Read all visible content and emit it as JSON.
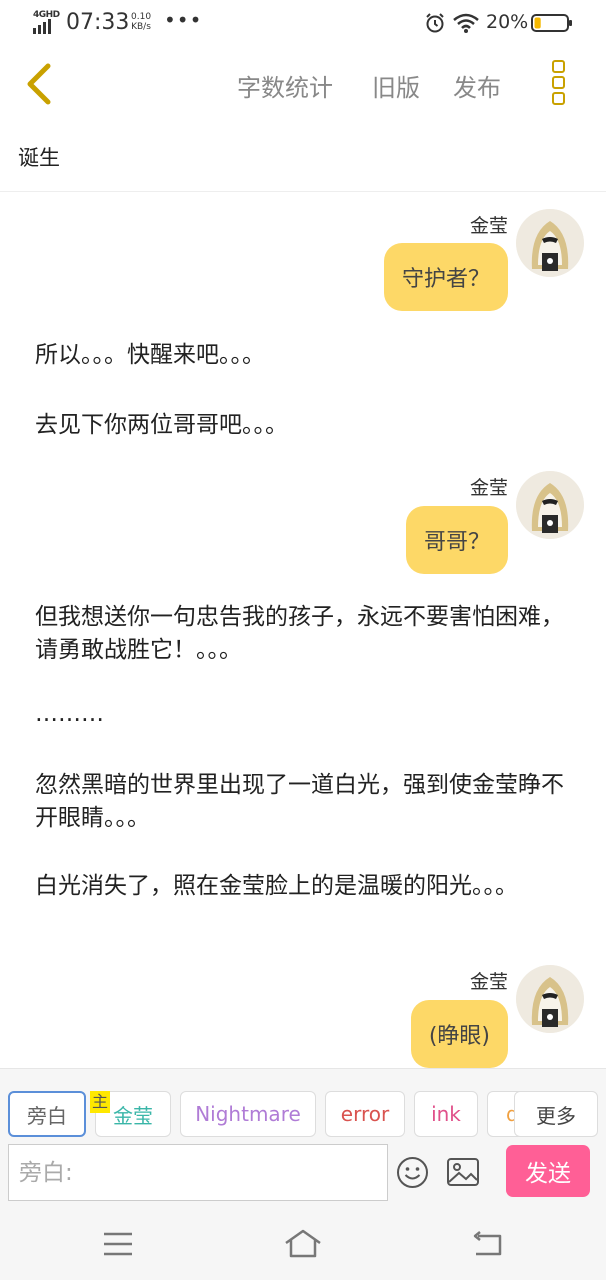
{
  "status_bar": {
    "network": "4GHD",
    "time": "07:33",
    "speed_value": "0.10",
    "speed_unit": "KB/s",
    "battery_text": "20%",
    "battery_level": 0.2,
    "icons": [
      "signal-icon",
      "alarm-icon",
      "wifi-icon",
      "battery-icon"
    ]
  },
  "header": {
    "back_icon": "chevron-left-icon",
    "word_count": "字数统计",
    "old_version": "旧版",
    "publish": "发布",
    "more_icon": "more-vertical-icon",
    "accent_color": "#c9a100"
  },
  "title": "诞生",
  "chat": {
    "bubble_color": "#fdd867",
    "messages": [
      {
        "type": "role",
        "speaker": "金莹",
        "text": "守护者？"
      },
      {
        "type": "narration",
        "text": "所以。。。快醒来吧。。。"
      },
      {
        "type": "narration",
        "text": "去见下你两位哥哥吧。。。"
      },
      {
        "type": "role",
        "speaker": "金莹",
        "text": "哥哥？"
      },
      {
        "type": "narration",
        "text": "但我想送你一句忠告我的孩子，永远不要害怕困难，请勇敢战胜它！。。。"
      },
      {
        "type": "narration",
        "text": "………"
      },
      {
        "type": "narration",
        "text": "忽然黑暗的世界里出现了一道白光，强到使金莹睁不开眼睛。。。"
      },
      {
        "type": "narration",
        "text": "白光消失了，照在金莹脸上的是温暖的阳光。。。"
      },
      {
        "type": "role",
        "speaker": "金莹",
        "text": "(睁眼)"
      }
    ]
  },
  "roles": {
    "chips": [
      {
        "label": "旁白",
        "color": "#666666",
        "selected": true
      },
      {
        "label": "金莹",
        "color": "#3ab6a8",
        "tag": "主"
      },
      {
        "label": "Nightmare",
        "color": "#b07cd6"
      },
      {
        "label": "error",
        "color": "#d9534f"
      },
      {
        "label": "ink",
        "color": "#e0508a"
      },
      {
        "label": "d",
        "color": "#f0a040"
      }
    ],
    "more": "更多"
  },
  "composer": {
    "placeholder": "旁白:",
    "emoji_icon": "emoji-icon",
    "image_icon": "image-icon",
    "send": "发送",
    "send_color": "#ff5f96"
  },
  "system_nav": {
    "icons": [
      "menu-icon",
      "home-icon",
      "back-icon"
    ]
  }
}
